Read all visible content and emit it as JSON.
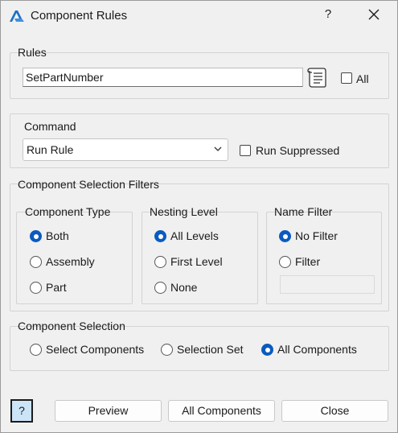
{
  "window": {
    "title": "Component Rules",
    "help_glyph": "?",
    "close_icon": "close-icon",
    "app_icon": "autodesk-a-icon"
  },
  "rules": {
    "group_label": "Rules",
    "value": "SetPartNumber",
    "browse_icon": "rules-list-icon",
    "all_label": "All",
    "all_checked": false
  },
  "command": {
    "group_label": "Command",
    "selected": "Run Rule",
    "run_suppressed_label": "Run Suppressed",
    "run_suppressed_checked": false
  },
  "filters": {
    "group_label": "Component Selection Filters",
    "component_type": {
      "label": "Component Type",
      "options": [
        "Both",
        "Assembly",
        "Part"
      ],
      "selected": "Both"
    },
    "nesting_level": {
      "label": "Nesting Level",
      "options": [
        "All Levels",
        "First Level",
        "None"
      ],
      "selected": "All Levels"
    },
    "name_filter": {
      "label": "Name Filter",
      "options": [
        "No Filter",
        "Filter"
      ],
      "selected": "No Filter",
      "filter_value": ""
    }
  },
  "selection": {
    "group_label": "Component Selection",
    "options": [
      "Select Components",
      "Selection Set",
      "All Components"
    ],
    "selected": "All Components"
  },
  "buttons": {
    "help": "?",
    "preview": "Preview",
    "all_components": "All Components",
    "close": "Close"
  },
  "colors": {
    "accent": "#0a5bbf",
    "help_button_bg": "#cce4f7"
  }
}
